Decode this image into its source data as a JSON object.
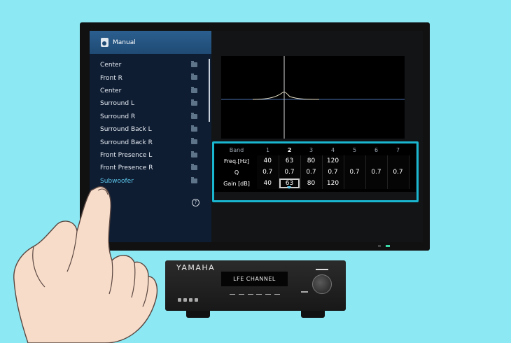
{
  "menu": {
    "title": "Manual",
    "channels": [
      {
        "label": "Center"
      },
      {
        "label": "Front R"
      },
      {
        "label": "Center"
      },
      {
        "label": "Surround L"
      },
      {
        "label": "Surround R"
      },
      {
        "label": "Surround Back L"
      },
      {
        "label": "Surround Back R"
      },
      {
        "label": "Front Presence L"
      },
      {
        "label": "Front Presence R"
      },
      {
        "label": "Subwoofer"
      }
    ],
    "active_channel": "Subwoofer",
    "help_glyph": "?"
  },
  "eq_table": {
    "band_label": "Band",
    "bands": [
      "1",
      "2",
      "3",
      "4",
      "5",
      "6",
      "7"
    ],
    "selected_band": "2",
    "freq_label": "Freq.[Hz]",
    "freq_values": [
      "40",
      "63",
      "80",
      "120",
      "",
      "",
      ""
    ],
    "q_label": "Q",
    "q_values": [
      "0.7",
      "0.7",
      "0.7",
      "0.7",
      "0.7",
      "0.7",
      "0.7"
    ],
    "gain_label": "Gain [dB]",
    "gain_values": [
      "40",
      "63",
      "80",
      "120",
      "",
      "",
      ""
    ]
  },
  "receiver": {
    "brand": "YAMAHA",
    "display_text": "LFE CHANNEL"
  },
  "colors": {
    "highlight": "#1ab6cf",
    "active_text": "#5cc8ec",
    "menu_header": "#2b5f8f",
    "background": "#8ce9f3"
  }
}
